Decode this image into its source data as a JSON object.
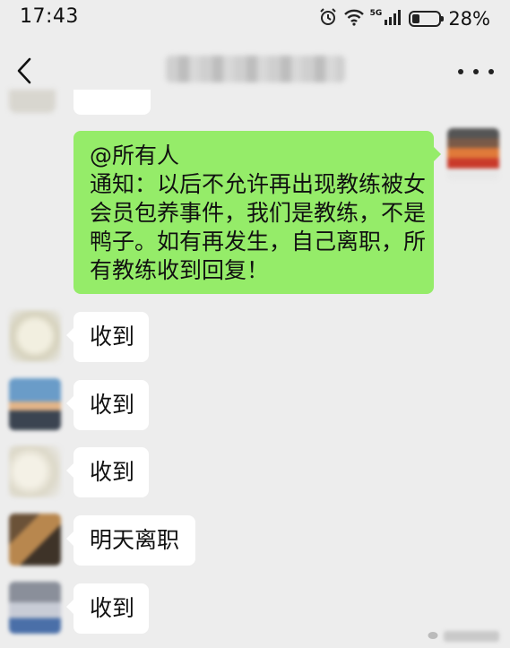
{
  "status_bar": {
    "time": "17:43",
    "network": "5G",
    "battery_percent": "28%",
    "battery_level": 0.28
  },
  "nav": {
    "back_icon": "chevron-left-icon",
    "more_icon": "more-dots-icon"
  },
  "messages": [
    {
      "sender": "self",
      "lines": [
        "@所有人",
        "通知：以后不允许再出现教练被女",
        "会员包养事件，我们是教练，不是",
        "鸭子。如有再发生，自己离职，所",
        "有教练收到回复！"
      ]
    },
    {
      "sender": "member-1",
      "text": "收到"
    },
    {
      "sender": "member-2",
      "text": "收到"
    },
    {
      "sender": "member-3",
      "text": "收到"
    },
    {
      "sender": "member-4",
      "text": "明天离职"
    },
    {
      "sender": "member-5",
      "text": "收到"
    }
  ],
  "colors": {
    "background": "#ededed",
    "outgoing_bubble": "#95ec69",
    "incoming_bubble": "#ffffff"
  }
}
